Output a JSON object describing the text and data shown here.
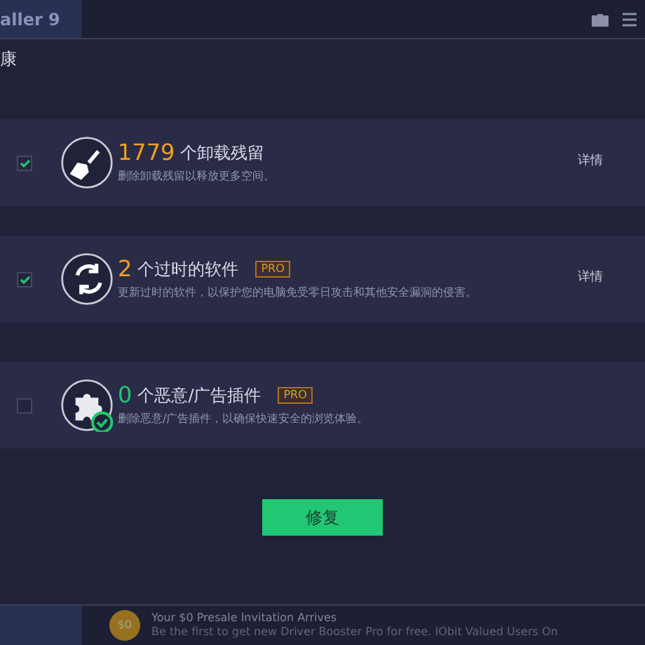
{
  "window": {
    "title": "aller 9"
  },
  "section_title": "康",
  "items": [
    {
      "kind": "leftovers",
      "checked": true,
      "count": "1779",
      "color": "#f0a020",
      "title": "个卸载残留",
      "pro": false,
      "description": "删除卸载残留以释放更多空间。",
      "details": "详情"
    },
    {
      "kind": "outdated",
      "checked": true,
      "count": "2",
      "color": "#f0a020",
      "title": "个过时的软件",
      "pro": true,
      "pro_label": "PRO",
      "description": "更新过时的软件，以保护您的电脑免受零日攻击和其他安全漏洞的侵害。",
      "details": "详情"
    },
    {
      "kind": "plugins",
      "checked": false,
      "count": "0",
      "color": "#22c46e",
      "title": "个恶意/广告插件",
      "pro": true,
      "pro_label": "PRO",
      "description": "删除恶意/广告插件，以确保快速安全的浏览体验。"
    }
  ],
  "fix_button": "修复",
  "promo": {
    "coin": "$0",
    "title": "Your $0 Presale Invitation Arrives",
    "text": "Be the first to get new Driver Booster Pro for free. IObit Valued Users On"
  }
}
